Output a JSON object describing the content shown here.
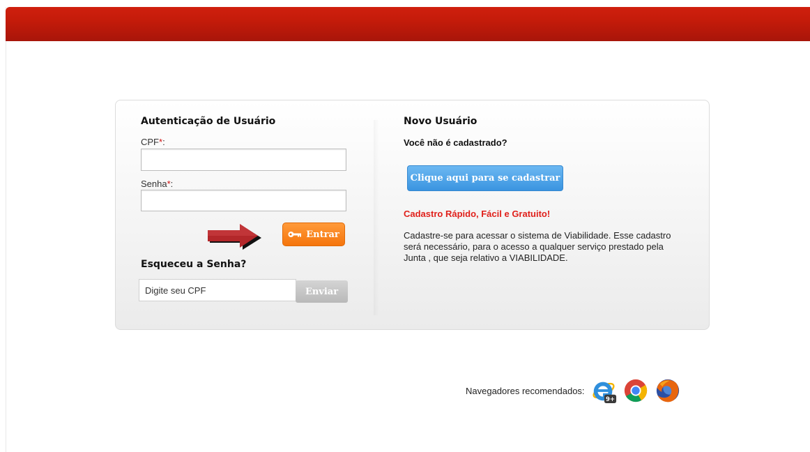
{
  "login": {
    "title": "Autenticação de Usuário",
    "cpf_label": "CPF",
    "senha_label": "Senha",
    "required_mark": "*",
    "label_suffix": ":",
    "cpf_value": "",
    "senha_value": "",
    "submit_label": "Entrar"
  },
  "recover": {
    "title": "Esqueceu a Senha?",
    "input_placeholder": "Digite seu CPF",
    "send_label": "Enviar"
  },
  "new_user": {
    "title": "Novo Usuário",
    "question": "Você não é cadastrado?",
    "register_button": "Clique aqui para se cadastrar",
    "promo": "Cadastro Rápido, Fácil e Gratuito!",
    "description": "Cadastre-se para acessar o sistema de Viabilidade. Esse cadastro será necessário, para o acesso a qualquer serviço prestado pela  Junta , que seja relativo a VIABILIDADE."
  },
  "footer": {
    "browsers_label": "Navegadores recomendados:",
    "ie_badge": "9+",
    "browsers": [
      "internet-explorer-icon",
      "chrome-icon",
      "firefox-icon"
    ]
  },
  "colors": {
    "header_red": "#c41b0a",
    "entrar_orange": "#f5750c",
    "register_blue": "#3a94e0",
    "promo_red": "#e0201b"
  }
}
